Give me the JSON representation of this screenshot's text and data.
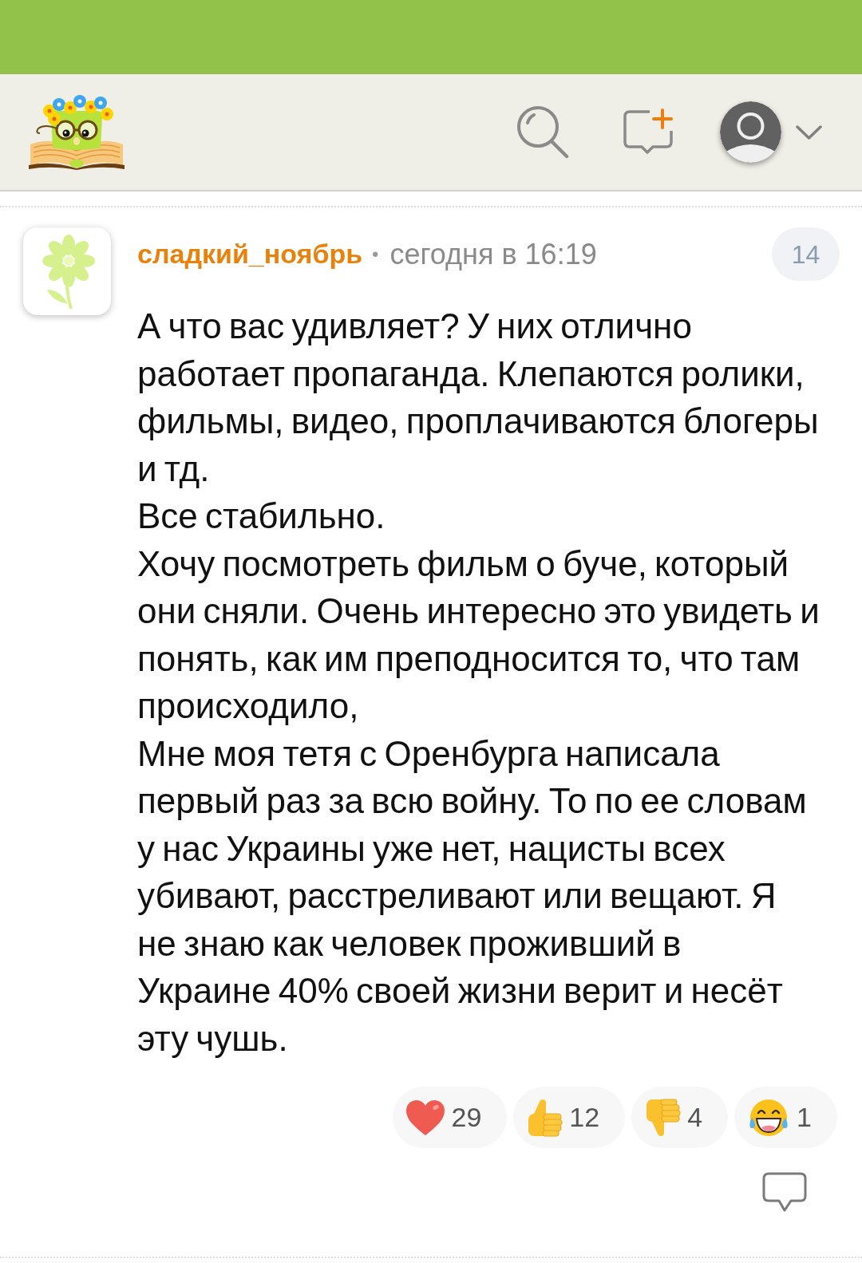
{
  "comment": {
    "author": "сладкий_ноябрь",
    "separator": "•",
    "time": "сегодня в 16:19",
    "number": "14",
    "paragraphs": [
      "А что вас удивляет? У них отлично работает пропаганда. Клепаются ролики, фильмы, видео, проплачиваются блогеры и тд.",
      "Все стабильно.",
      "Хочу посмотреть фильм о буче, который они сняли. Очень интересно это увидеть и понять, как им преподносится то, что там происходило,",
      "Мне моя тетя с Оренбурга написала первый раз за всю войну. То по ее словам у нас Украины уже нет, нацисты всех убивают, расстреливают или вещают. Я не знаю как человек проживший в Украине 40% своей жизни верит и несёт эту чушь."
    ],
    "reactions": [
      {
        "kind": "heart",
        "count": "29"
      },
      {
        "kind": "like",
        "count": "12"
      },
      {
        "kind": "dislike",
        "count": "4"
      },
      {
        "kind": "laugh",
        "count": "1"
      }
    ]
  }
}
